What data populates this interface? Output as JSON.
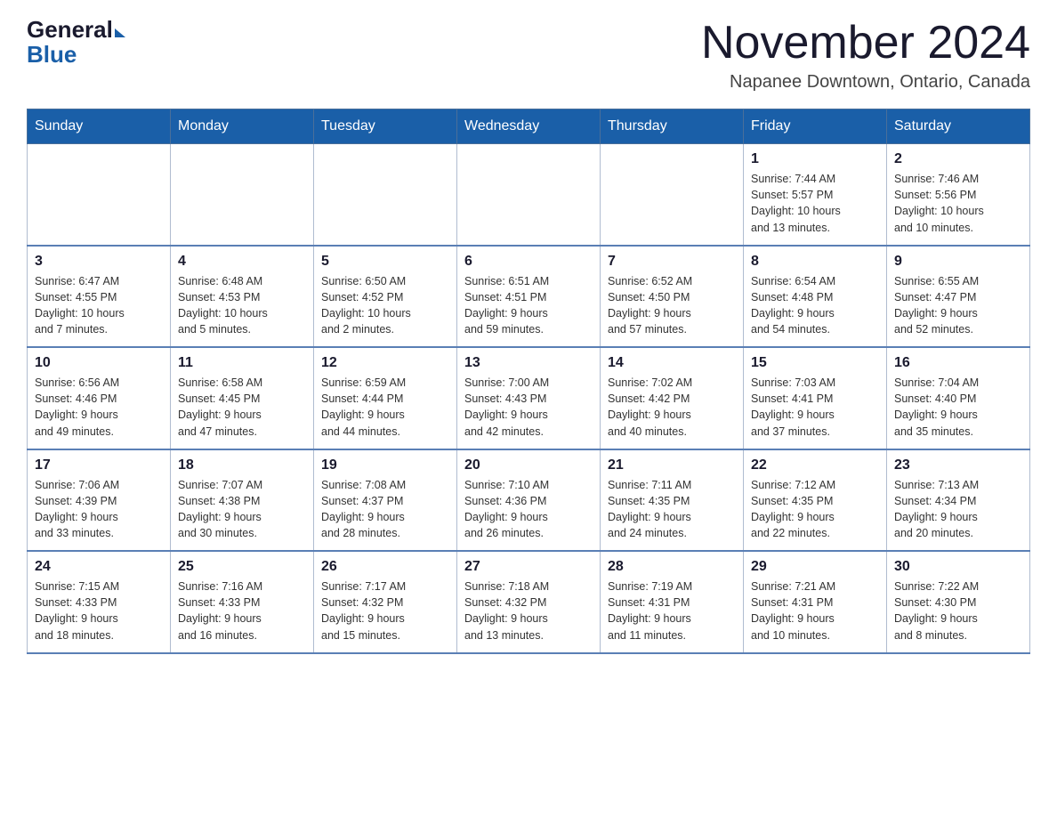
{
  "logo": {
    "general": "General",
    "blue": "Blue"
  },
  "title": "November 2024",
  "location": "Napanee Downtown, Ontario, Canada",
  "days_of_week": [
    "Sunday",
    "Monday",
    "Tuesday",
    "Wednesday",
    "Thursday",
    "Friday",
    "Saturday"
  ],
  "weeks": [
    [
      {
        "day": "",
        "info": ""
      },
      {
        "day": "",
        "info": ""
      },
      {
        "day": "",
        "info": ""
      },
      {
        "day": "",
        "info": ""
      },
      {
        "day": "",
        "info": ""
      },
      {
        "day": "1",
        "info": "Sunrise: 7:44 AM\nSunset: 5:57 PM\nDaylight: 10 hours\nand 13 minutes."
      },
      {
        "day": "2",
        "info": "Sunrise: 7:46 AM\nSunset: 5:56 PM\nDaylight: 10 hours\nand 10 minutes."
      }
    ],
    [
      {
        "day": "3",
        "info": "Sunrise: 6:47 AM\nSunset: 4:55 PM\nDaylight: 10 hours\nand 7 minutes."
      },
      {
        "day": "4",
        "info": "Sunrise: 6:48 AM\nSunset: 4:53 PM\nDaylight: 10 hours\nand 5 minutes."
      },
      {
        "day": "5",
        "info": "Sunrise: 6:50 AM\nSunset: 4:52 PM\nDaylight: 10 hours\nand 2 minutes."
      },
      {
        "day": "6",
        "info": "Sunrise: 6:51 AM\nSunset: 4:51 PM\nDaylight: 9 hours\nand 59 minutes."
      },
      {
        "day": "7",
        "info": "Sunrise: 6:52 AM\nSunset: 4:50 PM\nDaylight: 9 hours\nand 57 minutes."
      },
      {
        "day": "8",
        "info": "Sunrise: 6:54 AM\nSunset: 4:48 PM\nDaylight: 9 hours\nand 54 minutes."
      },
      {
        "day": "9",
        "info": "Sunrise: 6:55 AM\nSunset: 4:47 PM\nDaylight: 9 hours\nand 52 minutes."
      }
    ],
    [
      {
        "day": "10",
        "info": "Sunrise: 6:56 AM\nSunset: 4:46 PM\nDaylight: 9 hours\nand 49 minutes."
      },
      {
        "day": "11",
        "info": "Sunrise: 6:58 AM\nSunset: 4:45 PM\nDaylight: 9 hours\nand 47 minutes."
      },
      {
        "day": "12",
        "info": "Sunrise: 6:59 AM\nSunset: 4:44 PM\nDaylight: 9 hours\nand 44 minutes."
      },
      {
        "day": "13",
        "info": "Sunrise: 7:00 AM\nSunset: 4:43 PM\nDaylight: 9 hours\nand 42 minutes."
      },
      {
        "day": "14",
        "info": "Sunrise: 7:02 AM\nSunset: 4:42 PM\nDaylight: 9 hours\nand 40 minutes."
      },
      {
        "day": "15",
        "info": "Sunrise: 7:03 AM\nSunset: 4:41 PM\nDaylight: 9 hours\nand 37 minutes."
      },
      {
        "day": "16",
        "info": "Sunrise: 7:04 AM\nSunset: 4:40 PM\nDaylight: 9 hours\nand 35 minutes."
      }
    ],
    [
      {
        "day": "17",
        "info": "Sunrise: 7:06 AM\nSunset: 4:39 PM\nDaylight: 9 hours\nand 33 minutes."
      },
      {
        "day": "18",
        "info": "Sunrise: 7:07 AM\nSunset: 4:38 PM\nDaylight: 9 hours\nand 30 minutes."
      },
      {
        "day": "19",
        "info": "Sunrise: 7:08 AM\nSunset: 4:37 PM\nDaylight: 9 hours\nand 28 minutes."
      },
      {
        "day": "20",
        "info": "Sunrise: 7:10 AM\nSunset: 4:36 PM\nDaylight: 9 hours\nand 26 minutes."
      },
      {
        "day": "21",
        "info": "Sunrise: 7:11 AM\nSunset: 4:35 PM\nDaylight: 9 hours\nand 24 minutes."
      },
      {
        "day": "22",
        "info": "Sunrise: 7:12 AM\nSunset: 4:35 PM\nDaylight: 9 hours\nand 22 minutes."
      },
      {
        "day": "23",
        "info": "Sunrise: 7:13 AM\nSunset: 4:34 PM\nDaylight: 9 hours\nand 20 minutes."
      }
    ],
    [
      {
        "day": "24",
        "info": "Sunrise: 7:15 AM\nSunset: 4:33 PM\nDaylight: 9 hours\nand 18 minutes."
      },
      {
        "day": "25",
        "info": "Sunrise: 7:16 AM\nSunset: 4:33 PM\nDaylight: 9 hours\nand 16 minutes."
      },
      {
        "day": "26",
        "info": "Sunrise: 7:17 AM\nSunset: 4:32 PM\nDaylight: 9 hours\nand 15 minutes."
      },
      {
        "day": "27",
        "info": "Sunrise: 7:18 AM\nSunset: 4:32 PM\nDaylight: 9 hours\nand 13 minutes."
      },
      {
        "day": "28",
        "info": "Sunrise: 7:19 AM\nSunset: 4:31 PM\nDaylight: 9 hours\nand 11 minutes."
      },
      {
        "day": "29",
        "info": "Sunrise: 7:21 AM\nSunset: 4:31 PM\nDaylight: 9 hours\nand 10 minutes."
      },
      {
        "day": "30",
        "info": "Sunrise: 7:22 AM\nSunset: 4:30 PM\nDaylight: 9 hours\nand 8 minutes."
      }
    ]
  ]
}
